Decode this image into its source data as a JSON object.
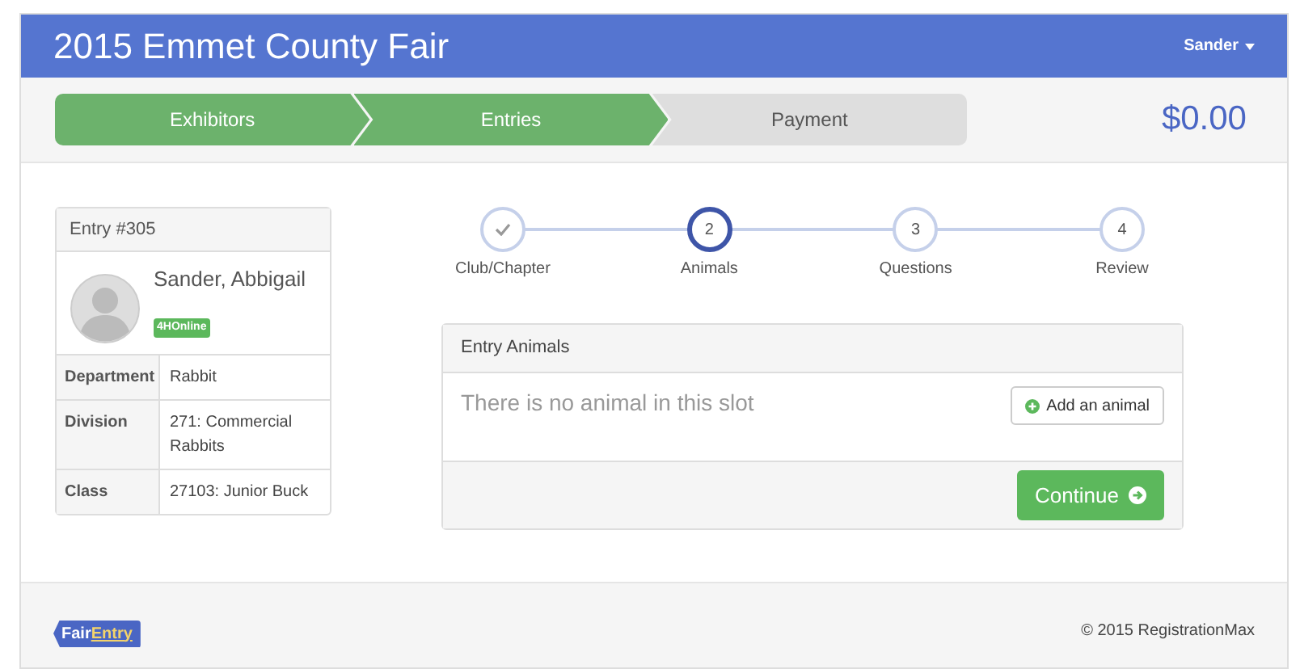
{
  "header": {
    "title": "2015 Emmet County Fair",
    "user_menu": "Sander"
  },
  "wizard": [
    {
      "label": "Exhibitors",
      "done": true
    },
    {
      "label": "Entries",
      "done": true
    },
    {
      "label": "Payment",
      "done": false
    }
  ],
  "total": "$0.00",
  "entry_card": {
    "title": "Entry #305",
    "name": "Sander, Abbigail",
    "badge": "4HOnline",
    "details": [
      {
        "label": "Department",
        "value": "Rabbit"
      },
      {
        "label": "Division",
        "value": "271: Commercial Rabbits"
      },
      {
        "label": "Class",
        "value": "27103: Junior Buck"
      }
    ]
  },
  "steps": [
    {
      "label": "Club/Chapter",
      "done": true,
      "selected": false
    },
    {
      "label": "Animals",
      "number": "2",
      "done": false,
      "selected": true
    },
    {
      "label": "Questions",
      "number": "3",
      "done": false,
      "selected": false
    },
    {
      "label": "Review",
      "number": "4",
      "done": false,
      "selected": false
    }
  ],
  "panel": {
    "title": "Entry Animals",
    "empty_text": "There is no animal in this slot",
    "add_button": "Add an animal",
    "continue_button": "Continue"
  },
  "footer": {
    "logo": [
      "Fair",
      "Entry"
    ],
    "copyright": "© 2015 RegistrationMax"
  }
}
